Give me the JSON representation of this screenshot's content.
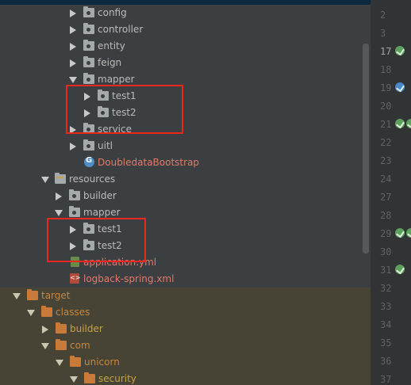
{
  "tree": {
    "rows": [
      {
        "label": "",
        "kind": "folder"
      },
      {
        "label": "config",
        "kind": "folder"
      },
      {
        "label": "controller",
        "kind": "folder"
      },
      {
        "label": "entity",
        "kind": "folder"
      },
      {
        "label": "feign",
        "kind": "folder"
      },
      {
        "label": "mapper",
        "kind": "folder"
      },
      {
        "label": "test1",
        "kind": "folder"
      },
      {
        "label": "test2",
        "kind": "folder"
      },
      {
        "label": "service",
        "kind": "folder"
      },
      {
        "label": "uitl",
        "kind": "folder"
      },
      {
        "label": "DoubledataBootstrap",
        "kind": "spring-class"
      },
      {
        "label": "resources",
        "kind": "resource-folder"
      },
      {
        "label": "builder",
        "kind": "folder"
      },
      {
        "label": "mapper",
        "kind": "folder"
      },
      {
        "label": "test1",
        "kind": "folder"
      },
      {
        "label": "test2",
        "kind": "folder"
      },
      {
        "label": "application.yml",
        "kind": "yml-file"
      },
      {
        "label": "logback-spring.xml",
        "kind": "xml-file"
      },
      {
        "label": "target",
        "kind": "excluded-folder"
      },
      {
        "label": "classes",
        "kind": "excluded-folder"
      },
      {
        "label": "builder",
        "kind": "excluded-folder"
      },
      {
        "label": "com",
        "kind": "excluded-folder"
      },
      {
        "label": "unicorn",
        "kind": "excluded-folder"
      },
      {
        "label": "security",
        "kind": "excluded-folder"
      }
    ]
  },
  "gutter": {
    "line_numbers": [
      "2",
      "3",
      "17",
      "18",
      "19",
      "20",
      "21",
      "22",
      "23",
      "24",
      "27",
      "28",
      "29",
      "30",
      "31",
      "32",
      "33",
      "34",
      "35",
      "36",
      "37"
    ],
    "highlighted_line": "17"
  },
  "annotations": {
    "box_color": "#e8281f"
  },
  "colors": {
    "panel_bg": "#3c3f41",
    "gutter_bg": "#313335",
    "excluded_bg": "#474436",
    "selected_bg": "#0d293e",
    "java_file_red": "#e07a6a"
  }
}
